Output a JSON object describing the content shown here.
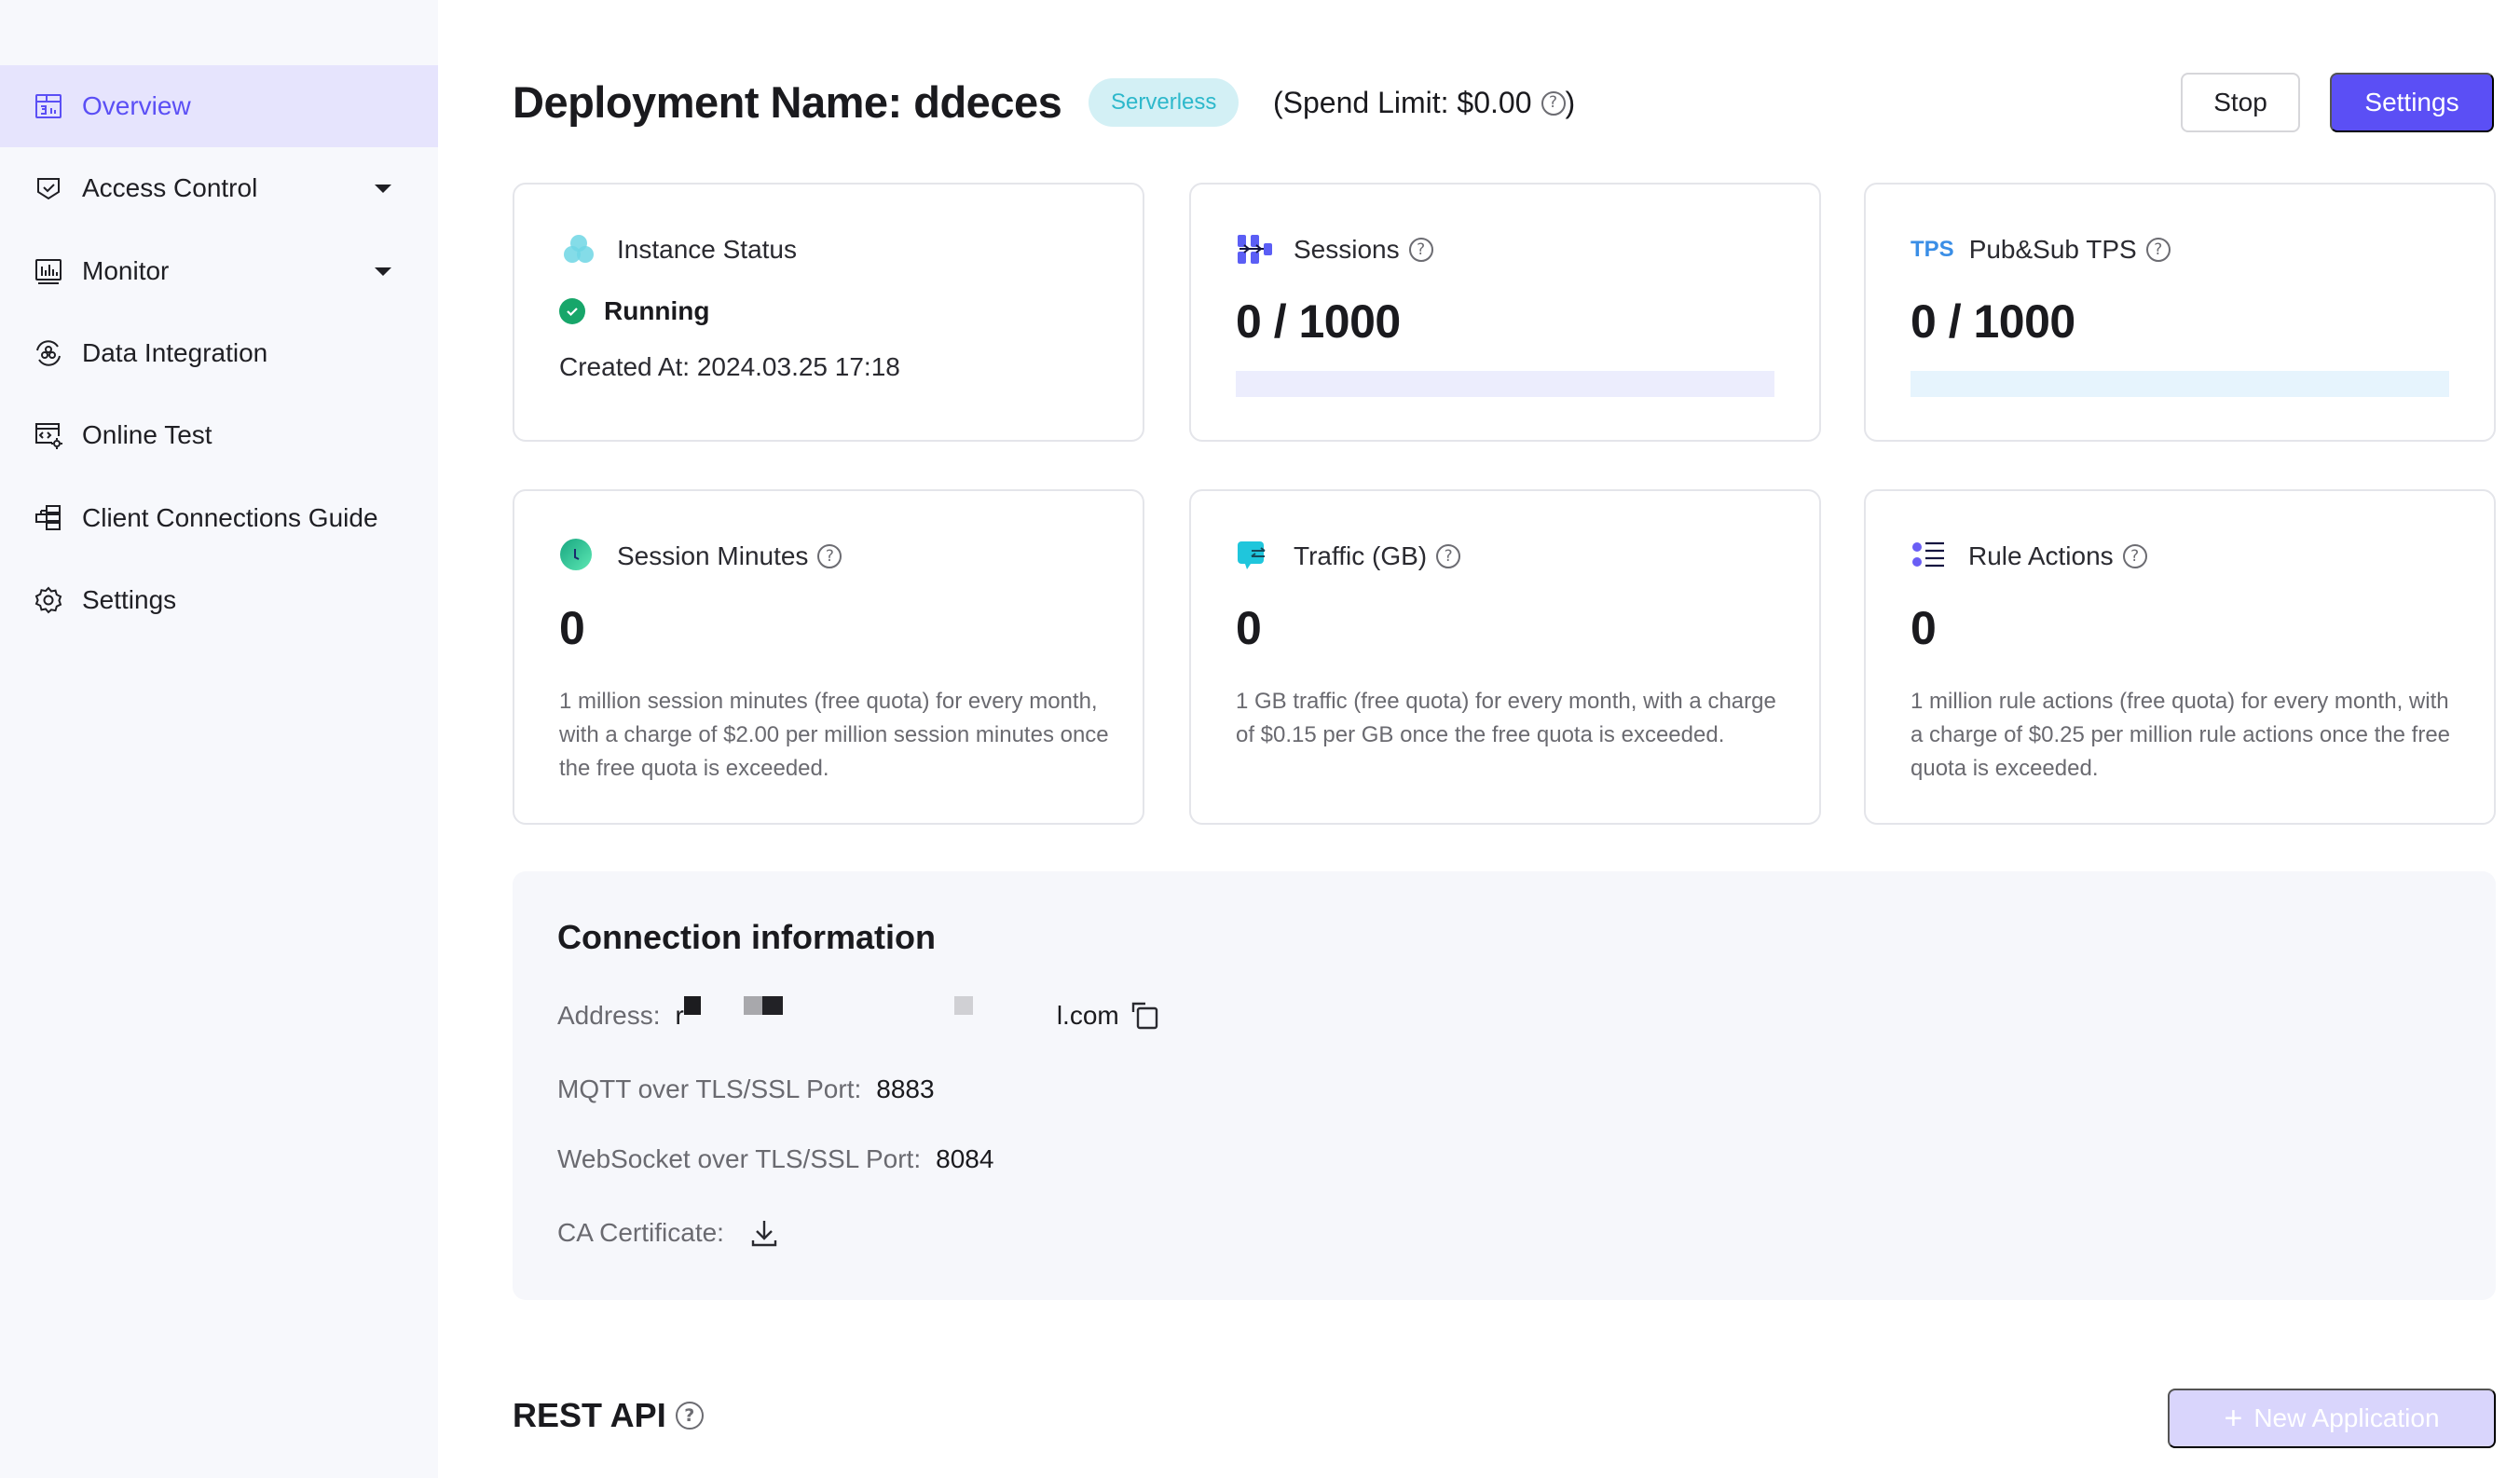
{
  "sidebar": {
    "items": [
      {
        "label": "Overview",
        "icon": "dashboard-icon",
        "active": true,
        "expandable": false
      },
      {
        "label": "Access Control",
        "icon": "shield-check-icon",
        "active": false,
        "expandable": true
      },
      {
        "label": "Monitor",
        "icon": "monitor-chart-icon",
        "active": false,
        "expandable": true
      },
      {
        "label": "Data Integration",
        "icon": "data-integration-icon",
        "active": false,
        "expandable": false
      },
      {
        "label": "Online Test",
        "icon": "code-window-gear-icon",
        "active": false,
        "expandable": false
      },
      {
        "label": "Client Connections Guide",
        "icon": "client-connections-icon",
        "active": false,
        "expandable": false
      },
      {
        "label": "Settings",
        "icon": "gear-icon",
        "active": false,
        "expandable": false
      }
    ]
  },
  "header": {
    "title": "Deployment Name: ddeces",
    "badge": "Serverless",
    "spend_limit": "(Spend Limit: $0.00",
    "spend_limit_close": ")",
    "help_glyph": "?",
    "stop_label": "Stop",
    "settings_label": "Settings"
  },
  "cards": {
    "instance_status": {
      "title": "Instance Status",
      "status": "Running",
      "created_at": "Created At: 2024.03.25 17:18"
    },
    "sessions": {
      "title": "Sessions",
      "value": "0 / 1000",
      "used": 0,
      "limit": 1000,
      "progress_fraction": 0
    },
    "tps": {
      "icon_text": "TPS",
      "title": "Pub&Sub TPS",
      "value": "0 / 1000",
      "used": 0,
      "limit": 1000,
      "progress_fraction": 0
    },
    "session_minutes": {
      "title": "Session Minutes",
      "value": "0",
      "description": "1 million session minutes (free quota) for every month, with a charge of $2.00 per million session minutes once the free quota is exceeded."
    },
    "traffic": {
      "title": "Traffic (GB)",
      "value": "0",
      "description": "1 GB traffic (free quota) for every month, with a charge of $0.15 per GB once the free quota is exceeded."
    },
    "rule_actions": {
      "title": "Rule Actions",
      "value": "0",
      "description": "1 million rule actions (free quota) for every month, with a charge of $0.25 per million rule actions once the free quota is exceeded."
    }
  },
  "connection": {
    "title": "Connection information",
    "address_label": "Address:",
    "address_prefix": "r",
    "address_suffix": "l.com",
    "mqtt_label": "MQTT over TLS/SSL Port:",
    "mqtt_port": "8883",
    "ws_label": "WebSocket over TLS/SSL Port:",
    "ws_port": "8084",
    "ca_label": "CA Certificate:"
  },
  "rest_api": {
    "title": "REST API",
    "new_app_plus": "+",
    "new_app_label": "New Application"
  },
  "colors": {
    "accent": "#5b4ff5",
    "sidebar_active_bg": "#e6e4fd",
    "badge_bg": "#d3f0f5",
    "badge_text": "#2db8cb",
    "running_green": "#17a66a",
    "sessions_bar": "#ecedfd",
    "tps_bar": "#e6f4fd",
    "tps_icon_blue": "#3a8ee6"
  }
}
